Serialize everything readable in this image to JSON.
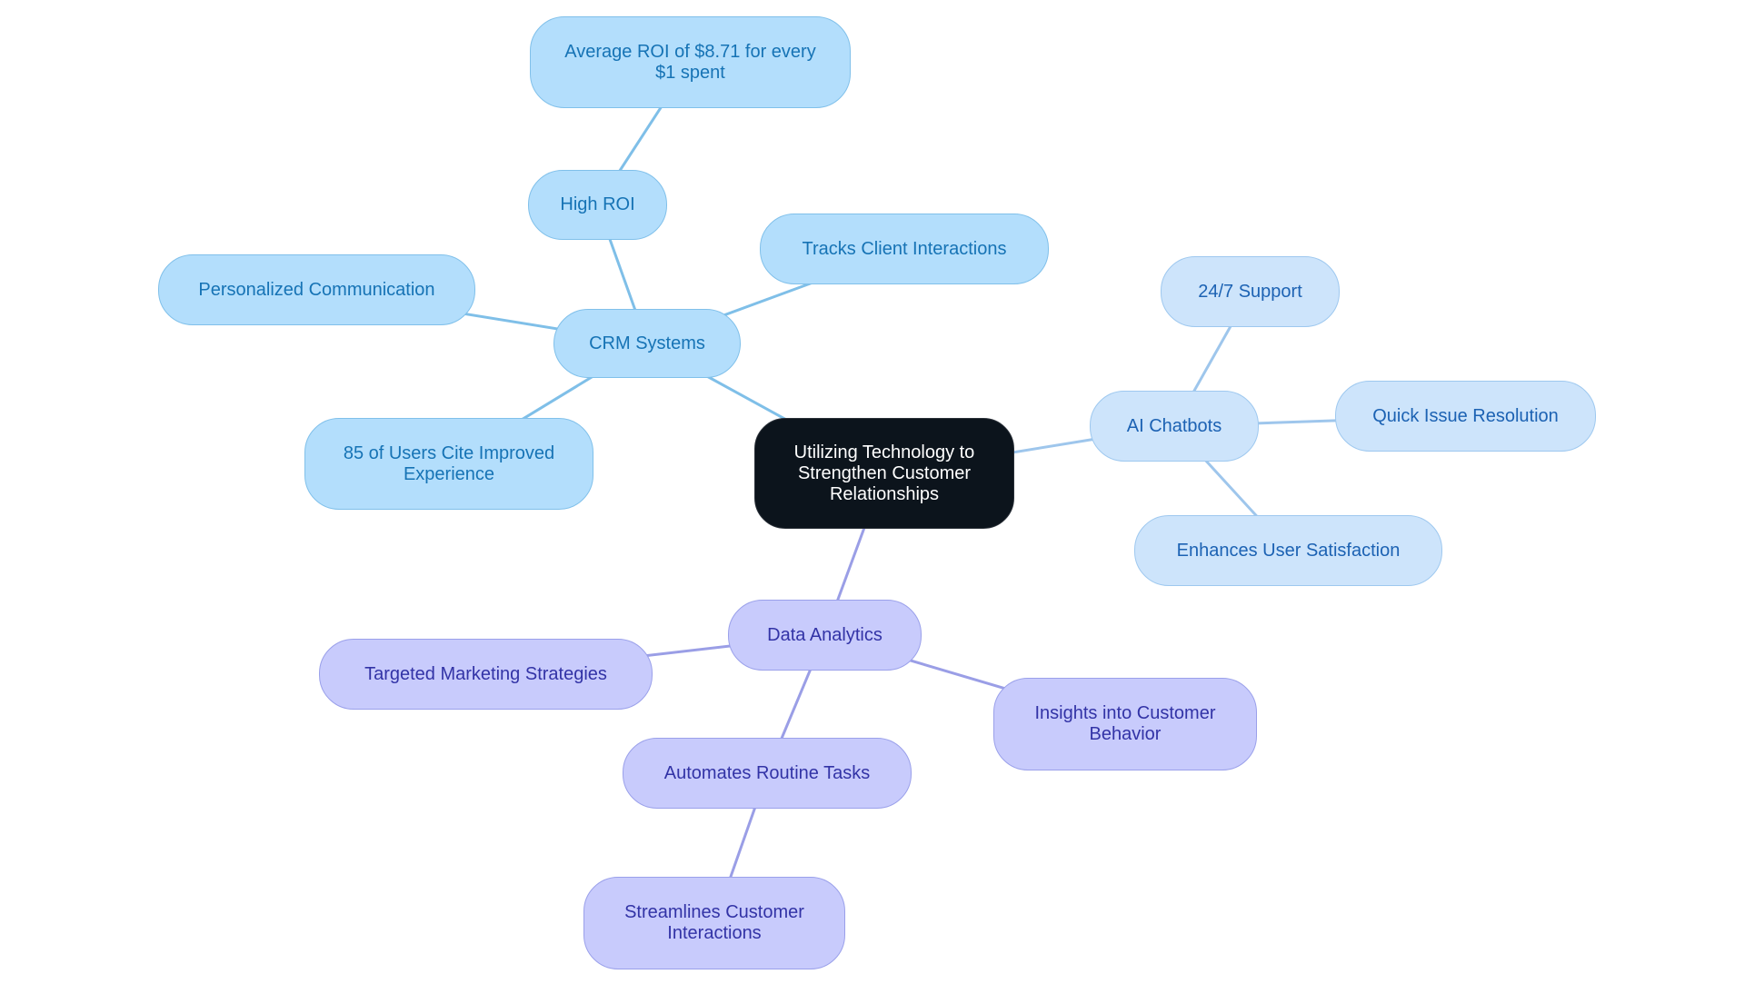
{
  "diagram": {
    "type": "mindmap",
    "root": {
      "id": "root",
      "label": "Utilizing Technology to Strengthen Customer Relationships"
    },
    "colors": {
      "root_fill": "#0c141c",
      "crm_fill": "#b3defc",
      "crm_text": "#1673b5",
      "crm_edge": "#7fbfe8",
      "ai_fill": "#cde4fb",
      "ai_text": "#1c62b3",
      "ai_edge": "#9ec6ec",
      "da_fill": "#c8cbfc",
      "da_text": "#3233a6",
      "da_edge": "#9a9ee6"
    },
    "nodes": [
      {
        "id": "root",
        "label": "Utilizing Technology to Strengthen Customer Relationships",
        "branch": "root"
      },
      {
        "id": "crm",
        "label": "CRM Systems",
        "branch": "crm",
        "parent": "root"
      },
      {
        "id": "high-roi",
        "label": "High ROI",
        "branch": "crm",
        "parent": "crm"
      },
      {
        "id": "avg-roi",
        "label": "Average ROI of $8.71 for every $1 spent",
        "branch": "crm",
        "parent": "high-roi"
      },
      {
        "id": "tracks",
        "label": "Tracks Client Interactions",
        "branch": "crm",
        "parent": "crm"
      },
      {
        "id": "personalized",
        "label": "Personalized Communication",
        "branch": "crm",
        "parent": "crm"
      },
      {
        "id": "users85",
        "label": "85 of Users Cite Improved Experience",
        "branch": "crm",
        "parent": "crm"
      },
      {
        "id": "ai",
        "label": "AI Chatbots",
        "branch": "ai",
        "parent": "root"
      },
      {
        "id": "support",
        "label": "24/7 Support",
        "branch": "ai",
        "parent": "ai"
      },
      {
        "id": "quick",
        "label": "Quick Issue Resolution",
        "branch": "ai",
        "parent": "ai"
      },
      {
        "id": "enhances",
        "label": "Enhances User Satisfaction",
        "branch": "ai",
        "parent": "ai"
      },
      {
        "id": "da",
        "label": "Data Analytics",
        "branch": "da",
        "parent": "root"
      },
      {
        "id": "targeted",
        "label": "Targeted Marketing Strategies",
        "branch": "da",
        "parent": "da"
      },
      {
        "id": "insights",
        "label": "Insights into Customer Behavior",
        "branch": "da",
        "parent": "da"
      },
      {
        "id": "automates",
        "label": "Automates Routine Tasks",
        "branch": "da",
        "parent": "da"
      },
      {
        "id": "streamlines",
        "label": "Streamlines Customer Interactions",
        "branch": "da",
        "parent": "automates"
      }
    ]
  }
}
